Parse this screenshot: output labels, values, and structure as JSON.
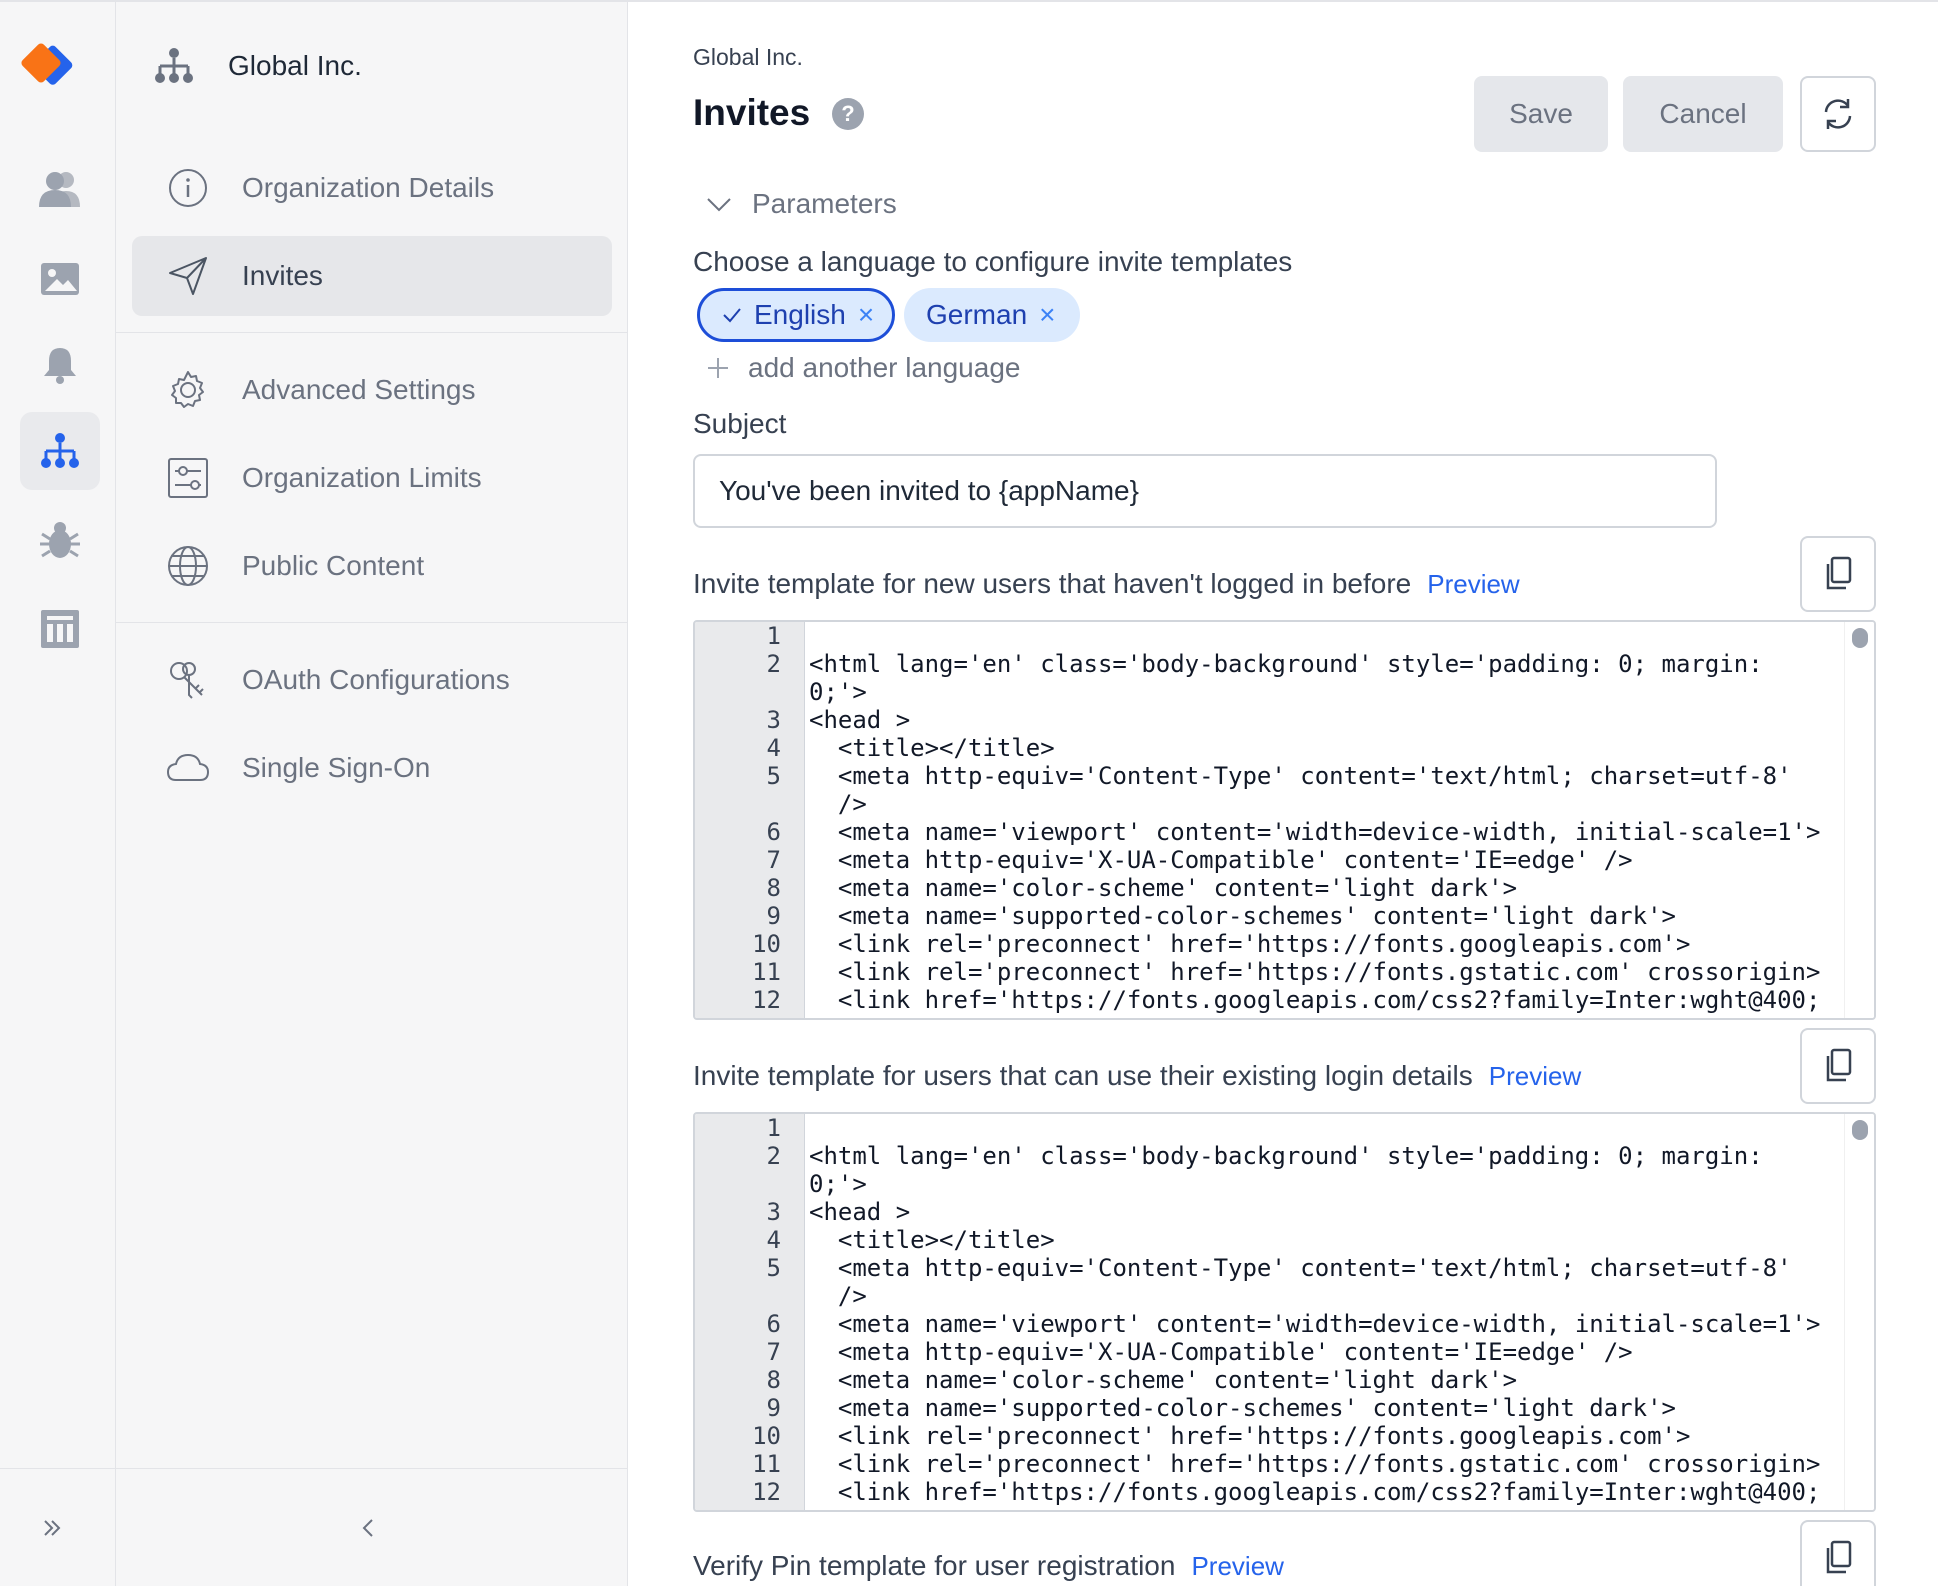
{
  "sidebar": {
    "org_name": "Global Inc.",
    "items": [
      {
        "label": "Organization Details",
        "icon": "info-icon"
      },
      {
        "label": "Invites",
        "icon": "send-icon",
        "active": true
      },
      {
        "label": "Advanced Settings",
        "icon": "gear-icon"
      },
      {
        "label": "Organization Limits",
        "icon": "sliders-icon"
      },
      {
        "label": "Public Content",
        "icon": "globe-icon"
      },
      {
        "label": "OAuth Configurations",
        "icon": "keys-icon"
      },
      {
        "label": "Single Sign-On",
        "icon": "cloud-icon"
      }
    ]
  },
  "rail": {
    "items": [
      "users-icon",
      "image-icon",
      "bell-icon",
      "org-icon",
      "bug-icon",
      "table-icon"
    ],
    "active": "org-icon"
  },
  "header": {
    "breadcrumb": "Global Inc.",
    "title": "Invites",
    "help": "?",
    "save_label": "Save",
    "cancel_label": "Cancel"
  },
  "parameters": {
    "label": "Parameters",
    "language_prompt": "Choose a language to configure invite templates",
    "languages": [
      {
        "name": "English",
        "selected": true
      },
      {
        "name": "German",
        "selected": false
      }
    ],
    "add_language": "add another language"
  },
  "subject": {
    "label": "Subject",
    "value": "You've been invited to {appName}"
  },
  "templates": [
    {
      "label": "Invite template for new users that haven't logged in before",
      "preview": "Preview"
    },
    {
      "label": "Invite template for users that can use their existing login details",
      "preview": "Preview"
    },
    {
      "label": "Verify Pin template for user registration",
      "preview": "Preview"
    }
  ],
  "code_lines": [
    {
      "n": "1",
      "t": ""
    },
    {
      "n": "2",
      "t": "<html lang='en' class='body-background' style='padding: 0; margin:"
    },
    {
      "n": "",
      "t": "0;'>"
    },
    {
      "n": "3",
      "t": "<head >"
    },
    {
      "n": "4",
      "t": "  <title></title>"
    },
    {
      "n": "5",
      "t": "  <meta http-equiv='Content-Type' content='text/html; charset=utf-8'"
    },
    {
      "n": "",
      "t": "  />"
    },
    {
      "n": "6",
      "t": "  <meta name='viewport' content='width=device-width, initial-scale=1'>"
    },
    {
      "n": "7",
      "t": "  <meta http-equiv='X-UA-Compatible' content='IE=edge' />"
    },
    {
      "n": "8",
      "t": "  <meta name='color-scheme' content='light dark'>"
    },
    {
      "n": "9",
      "t": "  <meta name='supported-color-schemes' content='light dark'>"
    },
    {
      "n": "10",
      "t": "  <link rel='preconnect' href='https://fonts.googleapis.com'>"
    },
    {
      "n": "11",
      "t": "  <link rel='preconnect' href='https://fonts.gstatic.com' crossorigin>"
    },
    {
      "n": "12",
      "t": "  <link href='https://fonts.googleapis.com/css2?family=Inter:wght@400;"
    }
  ],
  "colors": {
    "accent": "#2563eb",
    "chip_bg": "#dbeafe",
    "chip_text": "#1e40af",
    "sidebar_bg": "#f6f6f7",
    "logo_orange": "#f97316",
    "logo_blue": "#2563eb"
  }
}
